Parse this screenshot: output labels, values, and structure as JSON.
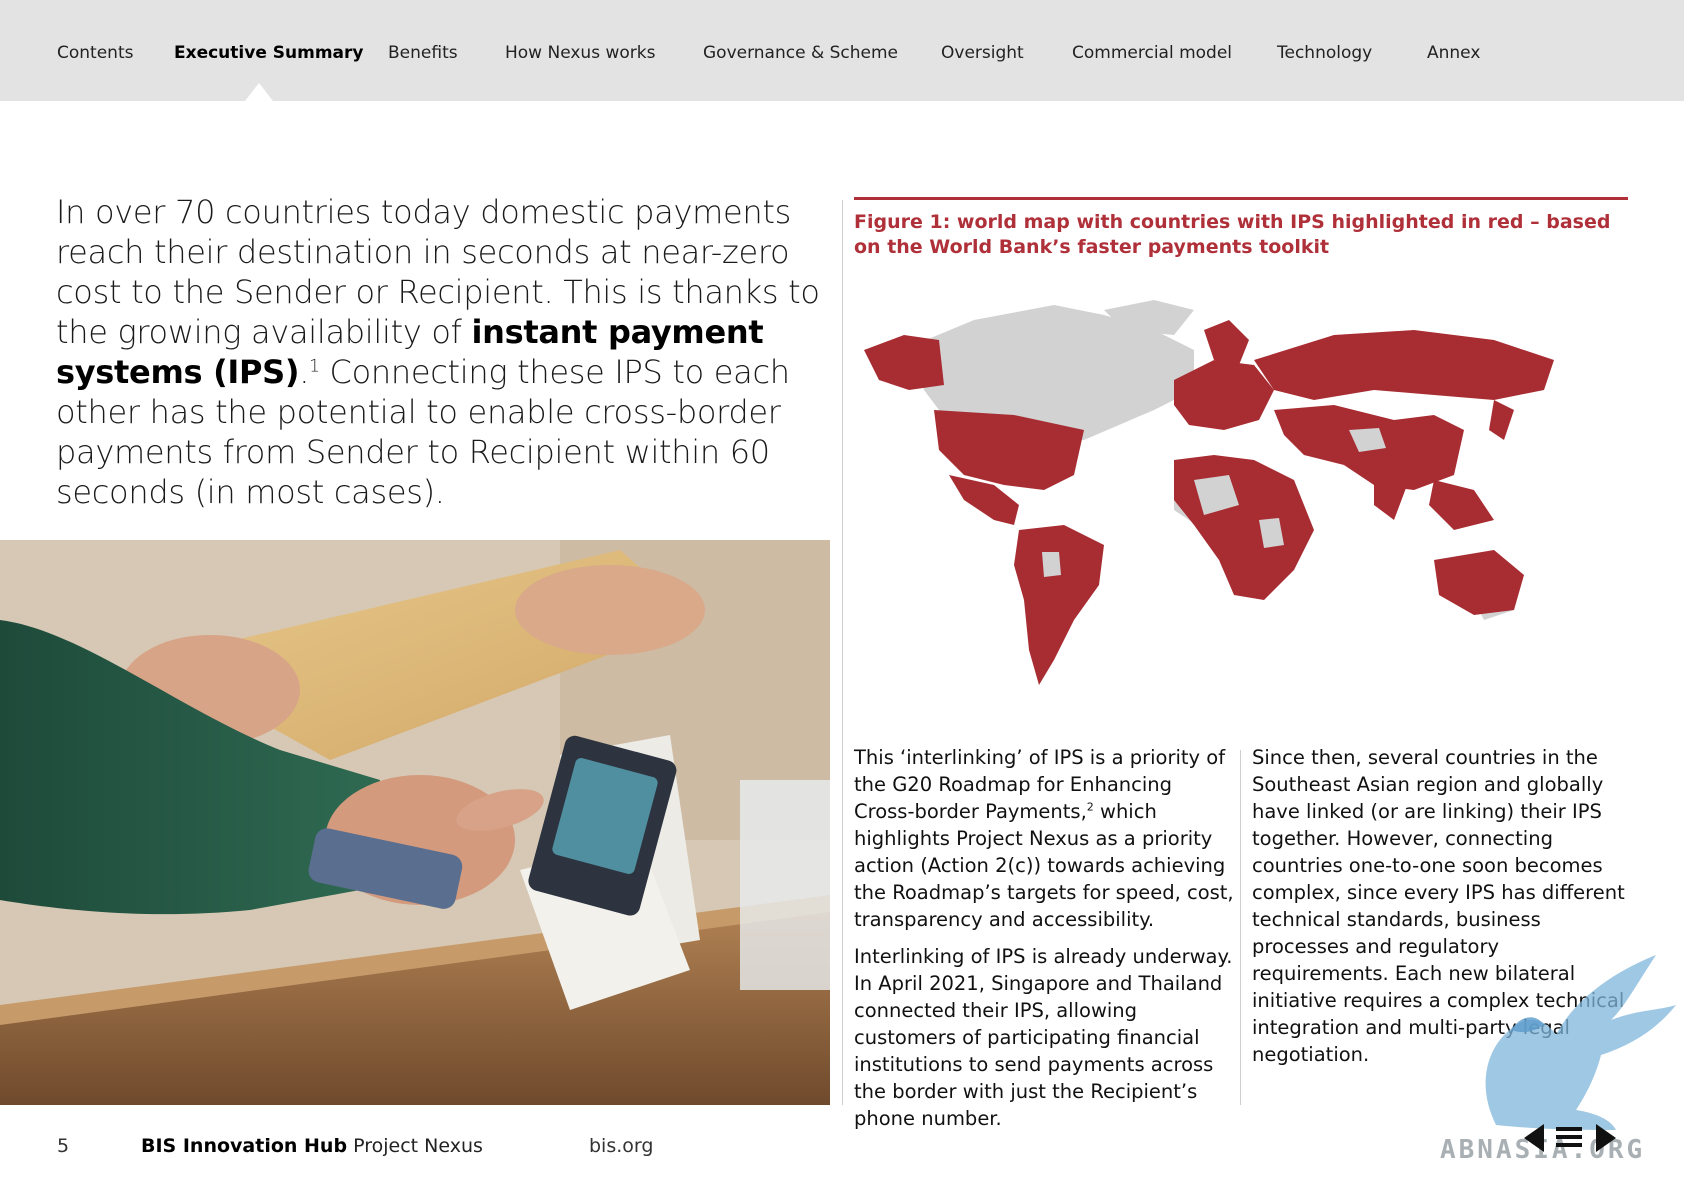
{
  "nav": {
    "items": [
      {
        "label": "Contents"
      },
      {
        "label": "Executive Summary"
      },
      {
        "label": "Benefits"
      },
      {
        "label": "How Nexus works"
      },
      {
        "label": "Governance & Scheme"
      },
      {
        "label": "Oversight"
      },
      {
        "label": "Commercial model"
      },
      {
        "label": "Technology"
      },
      {
        "label": "Annex"
      }
    ],
    "active": "Executive Summary"
  },
  "intro": {
    "text_before": "In over 70 countries today domestic payments reach their destination in seconds at near-zero cost to the Sender or Recipient. This is thanks to the growing availability of ",
    "bold": "instant payment systems (IPS)",
    "after_bold": ".",
    "footnote": "1",
    "text_after": " Connecting these IPS to each other has the potential to enable cross-border payments from Sender to Recipient within 60 seconds (in most cases)."
  },
  "figure": {
    "caption": "Figure 1: world map with countries with IPS highlighted in red – based on the World Bank’s faster payments toolkit",
    "highlight_color": "#a82d33",
    "base_color": "#d2d2d2"
  },
  "body": {
    "left_p1_a": "This ‘interlinking’ of IPS is a priority of the G20 Roadmap for Enhancing Cross-border Payments,",
    "left_p1_fn": "2",
    "left_p1_b": " which highlights Project Nexus as a priority action (Action 2(c)) towards achieving the Roadmap’s targets for speed, cost, transparency and accessibility.",
    "left_p2": "Interlinking of IPS is already underway. In April 2021, Singapore and Thailand connected their IPS, allowing customers of participating financial institutions to send payments across the border with just the Recipient’s phone number.",
    "right_p1": "Since then, several countries in the Southeast Asian region and globally have linked (or are linking) their IPS together. However, connecting countries one-to-one soon becomes complex, since every IPS has different technical standards, business processes and regulatory requirements. Each new bilateral initiative requires a complex technical integration and multi-party legal negotiation."
  },
  "footer": {
    "page": "5",
    "org_bold": "BIS Innovation Hub",
    "org_rest": " Project Nexus",
    "url": "bis.org"
  },
  "watermark": {
    "text": "ABNASIA.ORG"
  },
  "icons": [
    "prev-arrow-icon",
    "menu-icon",
    "next-arrow-icon"
  ]
}
